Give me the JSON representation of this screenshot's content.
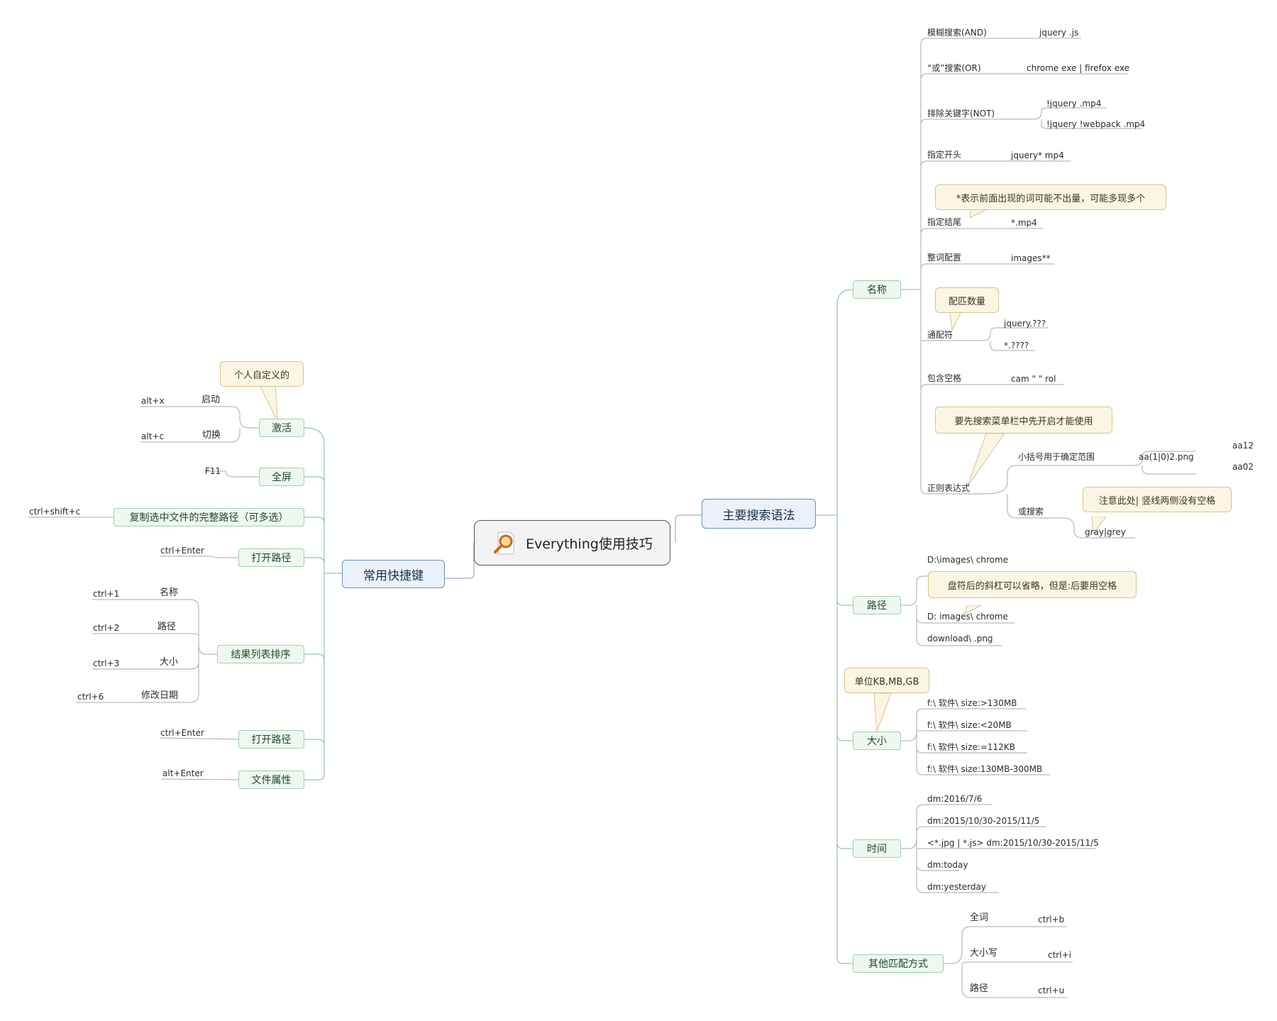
{
  "center": {
    "title": "Everything使用技巧",
    "icon": "magnifier-icon"
  },
  "left_branch": {
    "title": "常用快捷键",
    "activate": {
      "label": "激活",
      "note": "个人自定义的",
      "items": [
        {
          "key": "alt+x",
          "name": "启动"
        },
        {
          "key": "alt+c",
          "name": "切换"
        }
      ]
    },
    "fullscreen": {
      "label": "全屏",
      "key": "F11"
    },
    "copy_path": {
      "label": "复制选中文件的完整路径（可多选）",
      "key": "ctrl+shift+c"
    },
    "open_path1": {
      "label": "打开路径",
      "key": "ctrl+Enter"
    },
    "sort": {
      "label": "结果列表排序",
      "items": [
        {
          "key": "ctrl+1",
          "name": "名称"
        },
        {
          "key": "ctrl+2",
          "name": "路径"
        },
        {
          "key": "ctrl+3",
          "name": "大小"
        },
        {
          "key": "ctrl+6",
          "name": "修改日期"
        }
      ]
    },
    "open_path2": {
      "label": "打开路径",
      "key": "ctrl+Enter"
    },
    "properties": {
      "label": "文件属性",
      "key": "alt+Enter"
    }
  },
  "right_branch": {
    "title": "主要搜索语法",
    "name": {
      "label": "名称",
      "fuzzy": {
        "label": "模糊搜索(AND)",
        "example": "jquery .js"
      },
      "or": {
        "label": "“或”搜索(OR)",
        "example": "chrome exe | firefox exe"
      },
      "not": {
        "label": "排除关键字(NOT)",
        "examples": [
          "!jquery .mp4",
          "!jquery !webpack .mp4"
        ]
      },
      "start": {
        "label": "指定开头",
        "example": "jquery* mp4"
      },
      "star_note": "*表示前面出现的词可能不出量，可能多现多个",
      "end": {
        "label": "指定结尾",
        "example": "*.mp4"
      },
      "whole": {
        "label": "整词配置",
        "example": "images**"
      },
      "count_note": "配匹数量",
      "wildcard": {
        "label": "通配符",
        "examples": [
          "jquery.???",
          "*.????"
        ]
      },
      "space": {
        "label": "包含空格",
        "example": "cam \" \" rol"
      },
      "regex_note": "要先搜索菜单栏中先开启才能使用",
      "regex": {
        "label": "正则表达式",
        "paren": {
          "label": "小括号用于确定范围",
          "example": "aa(1|0)2.png",
          "results": [
            "aa12",
            "aa02"
          ]
        },
        "or_search": {
          "label": "或搜索",
          "example": "gray|grey",
          "note": "注意此处| 竖线两侧没有空格"
        }
      }
    },
    "path": {
      "label": "路径",
      "items": [
        "D:\\images\\  chrome",
        "D: images\\  chrome",
        "download\\ .png"
      ],
      "note": "盘符后的斜杠可以省略，但是:后要用空格"
    },
    "size": {
      "label": "大小",
      "note": "单位KB,MB,GB",
      "items": [
        "f:\\ 软件\\ size:>130MB",
        "f:\\ 软件\\ size:<20MB",
        "f:\\ 软件\\ size:=112KB",
        "f:\\ 软件\\ size:130MB-300MB"
      ]
    },
    "time": {
      "label": "时间",
      "items": [
        "dm:2016/7/6",
        "dm:2015/10/30-2015/11/5",
        "<*.jpg | *.js> dm:2015/10/30-2015/11/5",
        "dm:today",
        "dm:yesterday"
      ]
    },
    "other": {
      "label": "其他匹配方式",
      "items": [
        {
          "name": "全词",
          "key": "ctrl+b"
        },
        {
          "name": "大小写",
          "key": "ctrl+i"
        },
        {
          "name": "路径",
          "key": "ctrl+u"
        }
      ]
    }
  }
}
